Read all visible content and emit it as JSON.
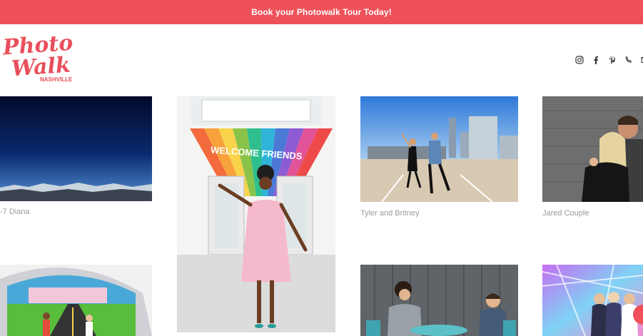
{
  "banner": {
    "text": "Book your Photowalk Tour Today!",
    "color": "#ee5159"
  },
  "logo": {
    "line1": "Photo",
    "line2": "Walk",
    "sub": "NASHVILLE",
    "color": "#e84f5c"
  },
  "social": [
    "instagram-icon",
    "facebook-icon",
    "pinterest-icon",
    "phone-icon",
    "email-icon"
  ],
  "gallery": {
    "captions": {
      "diana": "-7 Diana",
      "tyler": "Tyler and Britney",
      "jared": "Jared Couple"
    },
    "welcome_sign": "WELCOME FRIENDS"
  }
}
